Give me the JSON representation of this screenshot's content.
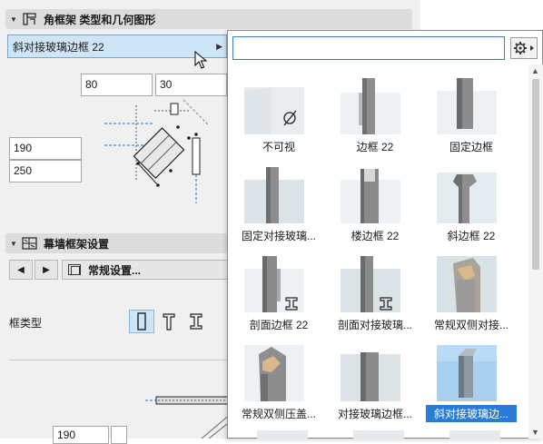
{
  "section_frame": {
    "title": "角框架 类型和几何图形"
  },
  "selected_type": "斜对接玻璃边框 22",
  "dimensions": {
    "width_a": "80",
    "width_b": "30",
    "depth_a": "190",
    "depth_b": "250",
    "bottom_value": "190"
  },
  "section_curtain": {
    "title": "幕墙框架设置"
  },
  "navigation": {
    "prev_icon": "arrow-left-icon",
    "next_icon": "arrow-right-icon"
  },
  "standard_settings": {
    "label": "常规设置..."
  },
  "frame_type": {
    "label": "框类型",
    "options": [
      "rectangular-frame-icon",
      "t-frame-icon",
      "i-frame-icon"
    ],
    "selected_index": 0
  },
  "picker": {
    "search_value": "",
    "settings_icon": "gear-icon",
    "items": [
      {
        "label": "不可视",
        "shape": "invisible"
      },
      {
        "label": "边框 22",
        "shape": "frame"
      },
      {
        "label": "固定边框",
        "shape": "fixed"
      },
      {
        "label": "固定对接玻璃...",
        "shape": "butt"
      },
      {
        "label": "楼边框 22",
        "shape": "channel"
      },
      {
        "label": "斜边框 22",
        "shape": "slanted"
      },
      {
        "label": "剖面边框 22",
        "shape": "profile"
      },
      {
        "label": "剖面对接玻璃...",
        "shape": "profile2"
      },
      {
        "label": "常规双侧对接...",
        "shape": "double"
      },
      {
        "label": "常规双侧压盖...",
        "shape": "cap"
      },
      {
        "label": "对接玻璃边框...",
        "shape": "butt2"
      },
      {
        "label": "斜对接玻璃边...",
        "shape": "miter",
        "selected": true
      }
    ]
  },
  "colors": {
    "accent": "#2a7bd6",
    "selection_bg": "#cde5f7",
    "panel_bg": "#f0f0f0"
  }
}
